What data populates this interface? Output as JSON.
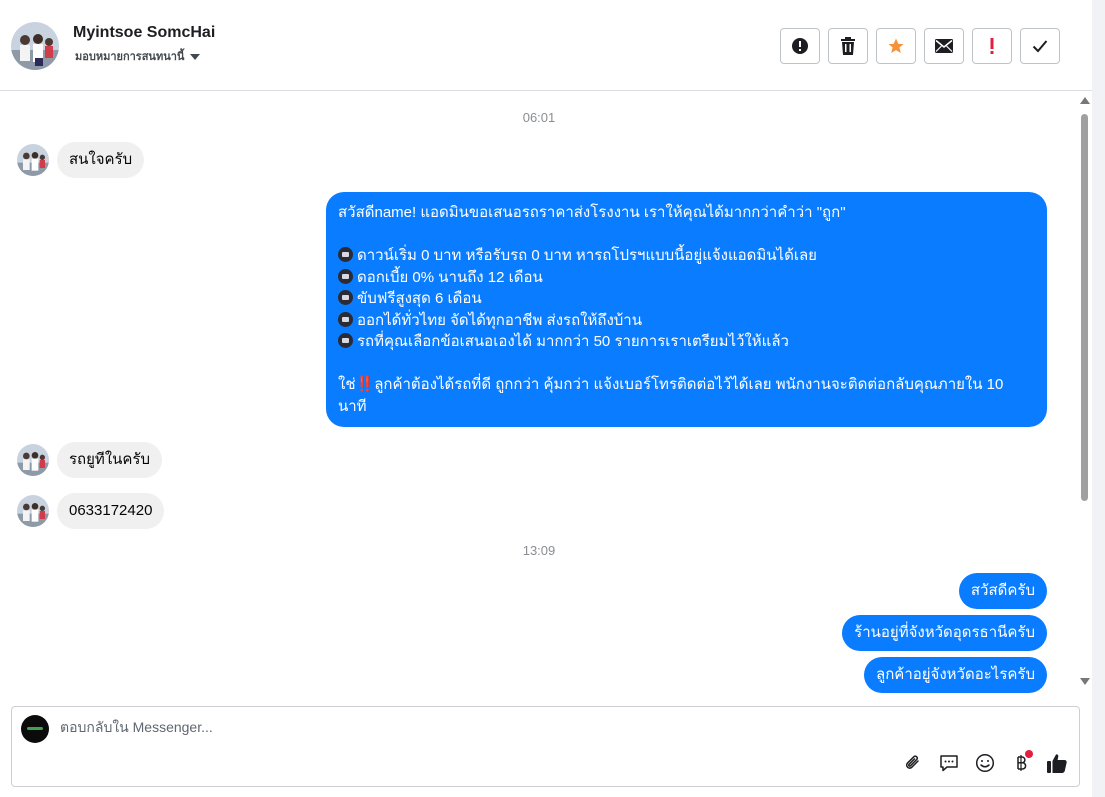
{
  "header": {
    "contact_name": "Myintsoe SomcHai",
    "assign_label": "มอบหมายการสนทนานี้",
    "actions": [
      {
        "name": "mark-spam-button",
        "icon": "alert-circle-icon"
      },
      {
        "name": "delete-button",
        "icon": "trash-icon"
      },
      {
        "name": "star-button",
        "icon": "star-icon"
      },
      {
        "name": "mark-unread-button",
        "icon": "envelope-icon"
      },
      {
        "name": "follow-up-button",
        "icon": "exclamation-icon"
      },
      {
        "name": "mark-done-button",
        "icon": "check-icon"
      }
    ],
    "star_color": "#f7923a",
    "followup_color": "#e41e3f"
  },
  "thread": {
    "time_1": "06:01",
    "in_msg_1": "สนใจครับ",
    "out_big": {
      "line1": "สวัสดีname! แอดมินขอเสนอรถราคาส่งโรงงาน เราให้คุณได้มากกว่าคำว่า \"ถูก\"",
      "bullet1": "ดาวน์เริ่ม 0 บาท หรือรับรถ 0 บาท หารถโปรฯแบบนี้อยู่แจ้งแอดมินได้เลย",
      "bullet2": "ดอกเบี้ย 0% นานถึง 12 เดือน",
      "bullet3": "ขับฟรีสูงสุด 6 เดือน",
      "bullet4": "ออกได้ทั่วไทย จัดได้ทุกอาชีพ ส่งรถให้ถึงบ้าน",
      "bullet5": "รถที่คุณเลือกข้อเสนอเองได้ มากกว่า 50 รายการเราเตรียมไว้ให้แล้ว",
      "closing_prefix": "ใช่",
      "closing_mark": "‼️",
      "closing_text": "ลูกค้าต้องได้รถที่ดี ถูกกว่า คุ้มกว่า แจ้งเบอร์โทรติดต่อไว้ได้เลย พนักงานจะติดต่อกลับคุณภายใน 10 นาที"
    },
    "in_msg_2": "รถยูทีในครับ",
    "in_msg_3": "0633172420",
    "time_2": "13:09",
    "out_msg_1": "สวัสดีครับ",
    "out_msg_2": "ร้านอยู่ที่จังหวัดอุดรธานีครับ",
    "out_msg_3": "ลูกค้าอยู่จังหวัดอะไรครับ",
    "outgoing_color": "#0a7cff"
  },
  "composer": {
    "placeholder": "ตอบกลับใน Messenger...",
    "tools": [
      "paperclip-icon",
      "chat-bubble-icon",
      "smiley-icon",
      "baht-icon",
      "thumbs-up-icon"
    ]
  }
}
